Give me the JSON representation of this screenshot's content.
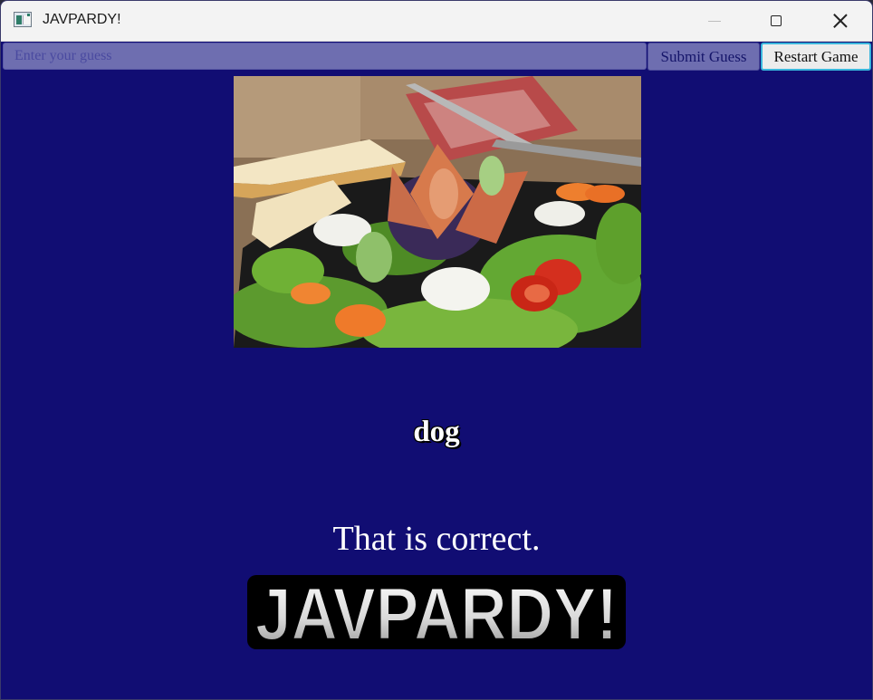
{
  "window": {
    "title": "JAVPARDY!",
    "app_icon": "app-window-icon",
    "controls": [
      "minimize-icon",
      "maximize-icon",
      "close-icon"
    ],
    "background_color": "#110d73"
  },
  "toolbar": {
    "guess_value": "",
    "guess_placeholder": "Enter your guess",
    "submit_label": "Submit Guess",
    "restart_label": "Restart Game"
  },
  "clue": {
    "image": "salad with figs, goat cheese, cherry tomatoes, carrots, cucumber, bread and fork on a slate board",
    "answer": "dog",
    "result_message": "That is correct."
  },
  "logo": {
    "text": "JAVPARDY!"
  }
}
